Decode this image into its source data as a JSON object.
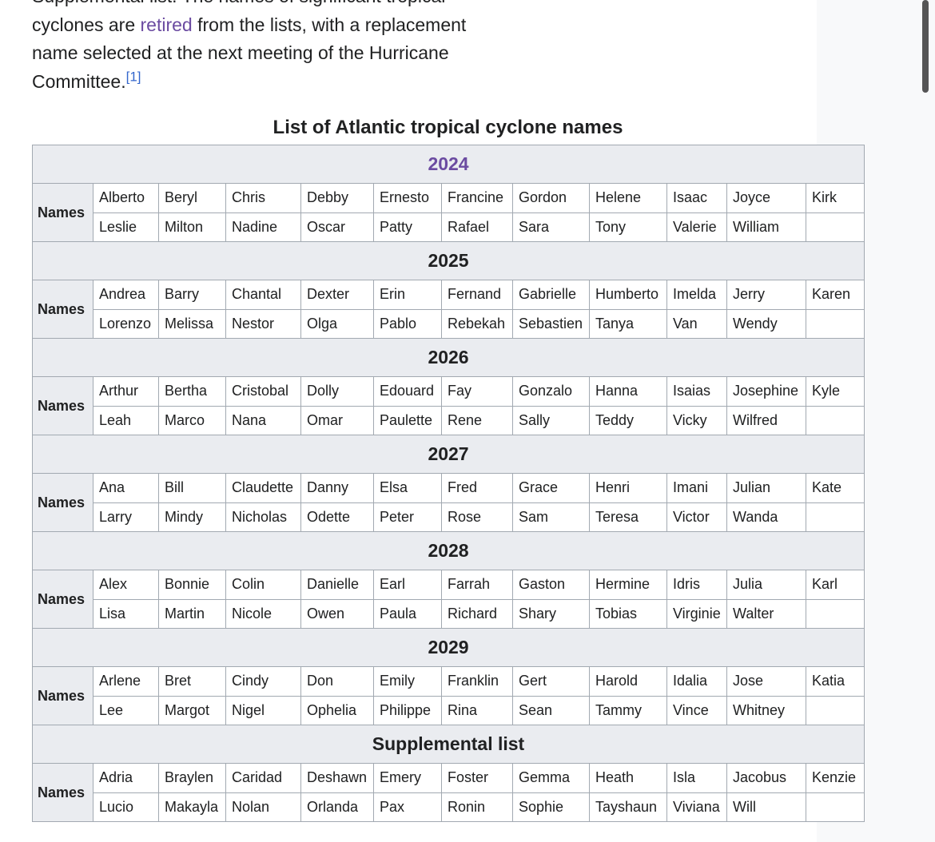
{
  "intro": {
    "line0": "Supplemental list. The names of significant tropical",
    "line1_pre": "cyclones are ",
    "line1_link": "retired",
    "line1_post": " from the lists, with a replacement",
    "line2": "name selected at the next meeting of the Hurricane",
    "line3": "Committee.",
    "ref": "[1]"
  },
  "table": {
    "caption": "List of Atlantic tropical cyclone names",
    "row_label": "Names",
    "sections": [
      {
        "title": "2024",
        "row1": [
          "Alberto",
          "Beryl",
          "Chris",
          "Debby",
          "Ernesto",
          "Francine",
          "Gordon",
          "Helene",
          "Isaac",
          "Joyce",
          "Kirk"
        ],
        "row2": [
          "Leslie",
          "Milton",
          "Nadine",
          "Oscar",
          "Patty",
          "Rafael",
          "Sara",
          "Tony",
          "Valerie",
          "William",
          ""
        ]
      },
      {
        "title": "2025",
        "row1": [
          "Andrea",
          "Barry",
          "Chantal",
          "Dexter",
          "Erin",
          "Fernand",
          "Gabrielle",
          "Humberto",
          "Imelda",
          "Jerry",
          "Karen"
        ],
        "row2": [
          "Lorenzo",
          "Melissa",
          "Nestor",
          "Olga",
          "Pablo",
          "Rebekah",
          "Sebastien",
          "Tanya",
          "Van",
          "Wendy",
          ""
        ]
      },
      {
        "title": "2026",
        "row1": [
          "Arthur",
          "Bertha",
          "Cristobal",
          "Dolly",
          "Edouard",
          "Fay",
          "Gonzalo",
          "Hanna",
          "Isaias",
          "Josephine",
          "Kyle"
        ],
        "row2": [
          "Leah",
          "Marco",
          "Nana",
          "Omar",
          "Paulette",
          "Rene",
          "Sally",
          "Teddy",
          "Vicky",
          "Wilfred",
          ""
        ]
      },
      {
        "title": "2027",
        "row1": [
          "Ana",
          "Bill",
          "Claudette",
          "Danny",
          "Elsa",
          "Fred",
          "Grace",
          "Henri",
          "Imani",
          "Julian",
          "Kate"
        ],
        "row2": [
          "Larry",
          "Mindy",
          "Nicholas",
          "Odette",
          "Peter",
          "Rose",
          "Sam",
          "Teresa",
          "Victor",
          "Wanda",
          ""
        ]
      },
      {
        "title": "2028",
        "row1": [
          "Alex",
          "Bonnie",
          "Colin",
          "Danielle",
          "Earl",
          "Farrah",
          "Gaston",
          "Hermine",
          "Idris",
          "Julia",
          "Karl"
        ],
        "row2": [
          "Lisa",
          "Martin",
          "Nicole",
          "Owen",
          "Paula",
          "Richard",
          "Shary",
          "Tobias",
          "Virginie",
          "Walter",
          ""
        ]
      },
      {
        "title": "2029",
        "row1": [
          "Arlene",
          "Bret",
          "Cindy",
          "Don",
          "Emily",
          "Franklin",
          "Gert",
          "Harold",
          "Idalia",
          "Jose",
          "Katia"
        ],
        "row2": [
          "Lee",
          "Margot",
          "Nigel",
          "Ophelia",
          "Philippe",
          "Rina",
          "Sean",
          "Tammy",
          "Vince",
          "Whitney",
          ""
        ]
      },
      {
        "title": "Supplemental list",
        "row1": [
          "Adria",
          "Braylen",
          "Caridad",
          "Deshawn",
          "Emery",
          "Foster",
          "Gemma",
          "Heath",
          "Isla",
          "Jacobus",
          "Kenzie"
        ],
        "row2": [
          "Lucio",
          "Makayla",
          "Nolan",
          "Orlanda",
          "Pax",
          "Ronin",
          "Sophie",
          "Tayshaun",
          "Viviana",
          "Will",
          ""
        ]
      }
    ]
  },
  "colors": {
    "link": "#6b4ba1",
    "ref_link": "#3366cc",
    "header_bg": "#eaecf0",
    "border": "#a2a9b1",
    "text": "#202122"
  }
}
